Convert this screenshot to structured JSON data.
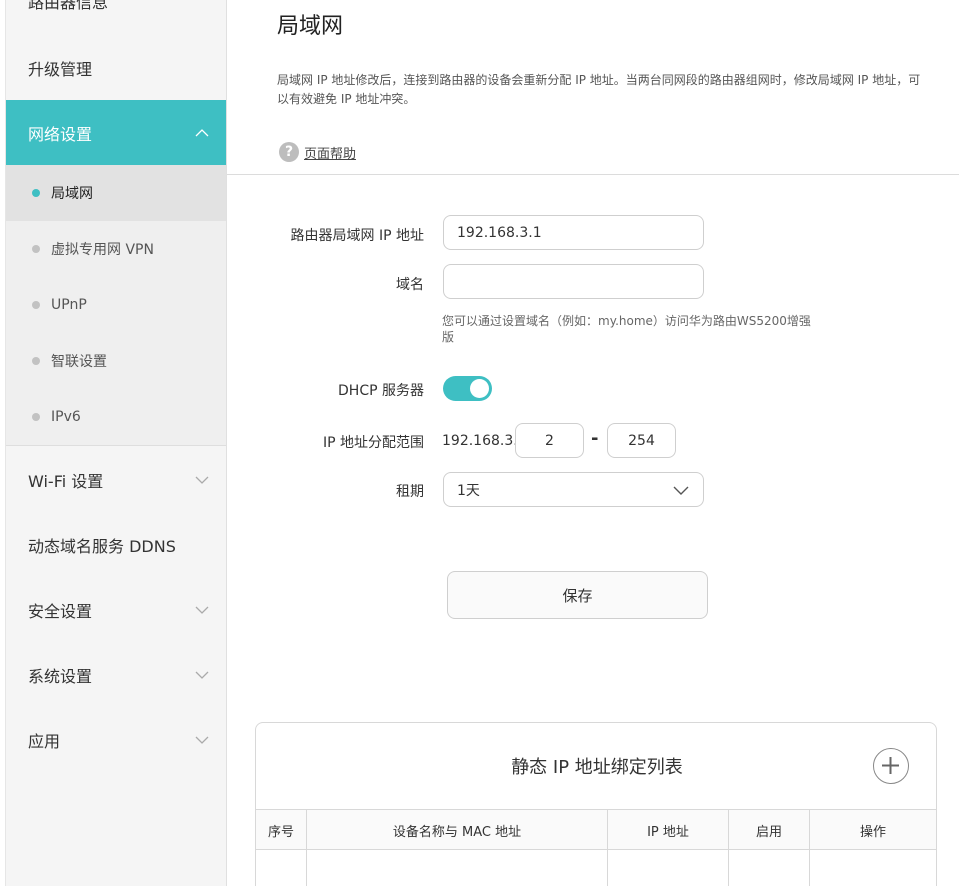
{
  "sidebar": {
    "top_partial_label": "路由器信息",
    "items": [
      {
        "label": "升级管理"
      },
      {
        "label": "网络设置"
      },
      {
        "label": "Wi-Fi 设置"
      },
      {
        "label": "动态域名服务 DDNS"
      },
      {
        "label": "安全设置"
      },
      {
        "label": "系统设置"
      },
      {
        "label": "应用"
      }
    ],
    "sub_items": [
      {
        "label": "局域网"
      },
      {
        "label": "虚拟专用网 VPN"
      },
      {
        "label": "UPnP"
      },
      {
        "label": "智联设置"
      },
      {
        "label": "IPv6"
      }
    ]
  },
  "page": {
    "title": "局域网",
    "description": "局域网 IP 地址修改后，连接到路由器的设备会重新分配 IP 地址。当两台同网段的路由器组网时，修改局域网 IP 地址，可以有效避免 IP 地址冲突。",
    "help_label": "页面帮助"
  },
  "form": {
    "lan_ip_label": "路由器局域网 IP 地址",
    "lan_ip_value": "192.168.3.1",
    "domain_label": "域名",
    "domain_value": "",
    "domain_hint": "您可以通过设置域名（例如：my.home）访问华为路由WS5200增强版",
    "dhcp_label": "DHCP 服务器",
    "dhcp_enabled": true,
    "range_label": "IP 地址分配范围",
    "range_prefix": "192.168.3.",
    "range_start": "2",
    "range_separator": "-",
    "range_end": "254",
    "lease_label": "租期",
    "lease_value": "1天",
    "save_label": "保存"
  },
  "static_table": {
    "title": "静态 IP 地址绑定列表",
    "columns": [
      "序号",
      "设备名称与 MAC 地址",
      "IP 地址",
      "启用",
      "操作"
    ]
  },
  "colors": {
    "accent": "#3ebfc3",
    "sidebar_bg": "#f5f5f5"
  }
}
